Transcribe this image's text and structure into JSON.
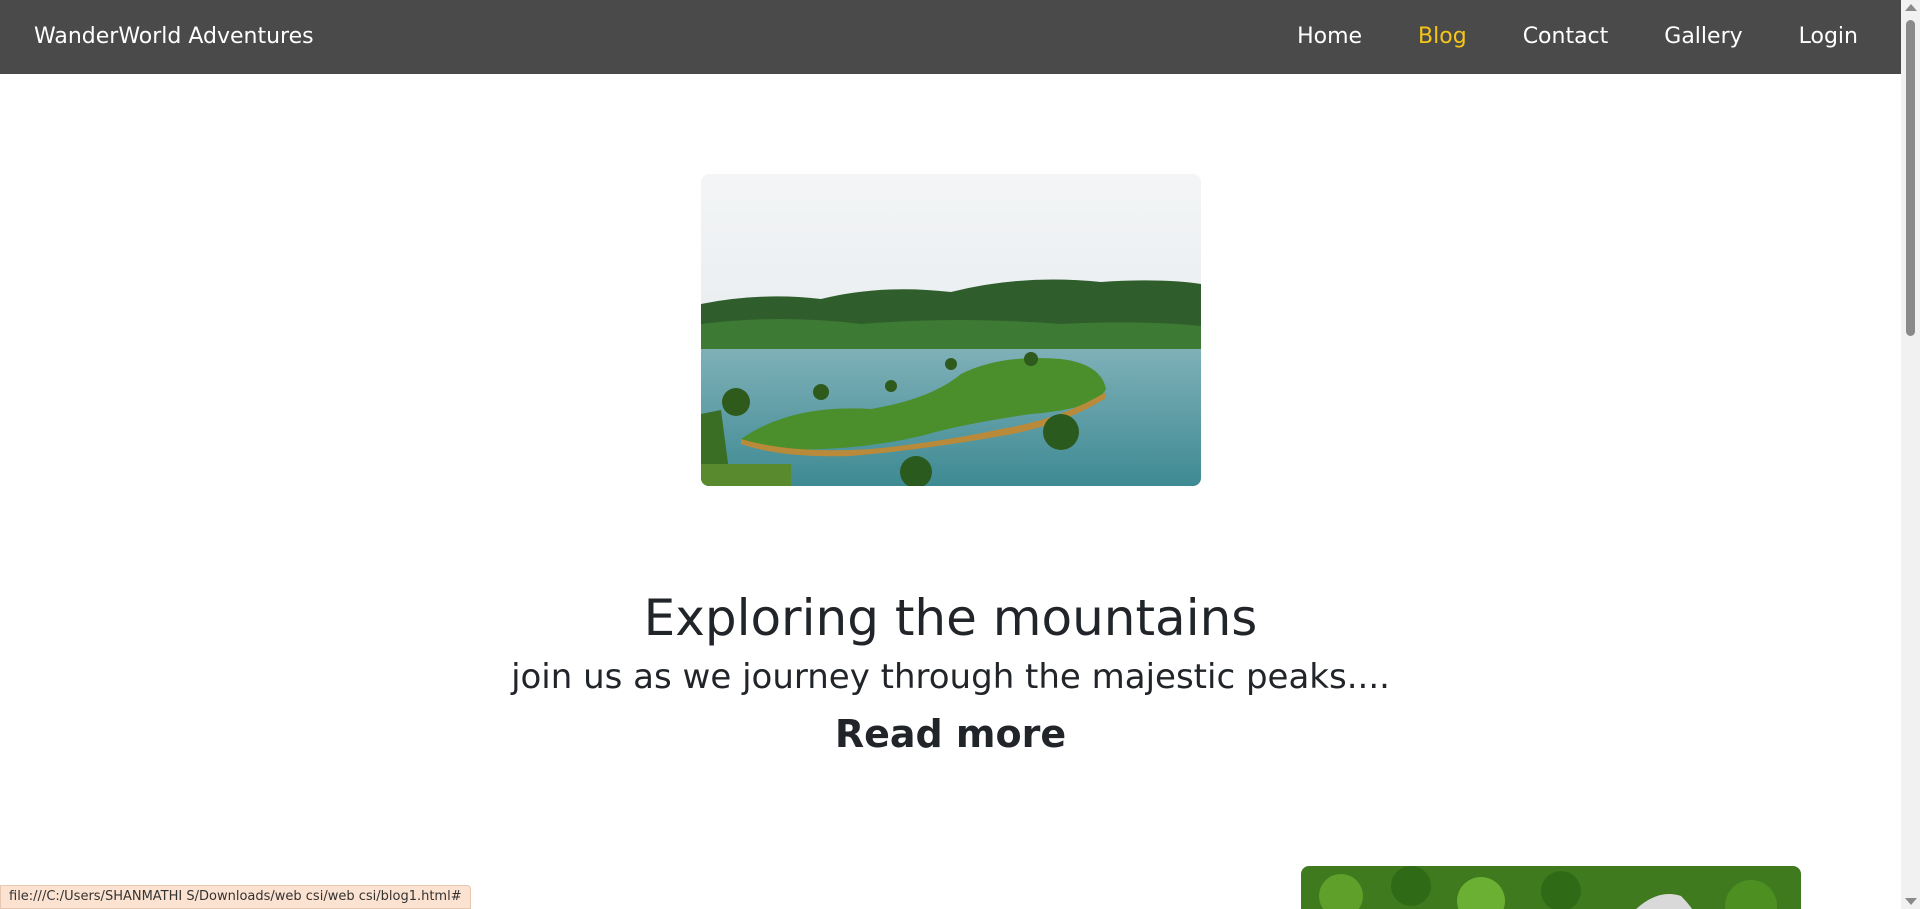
{
  "navbar": {
    "brand": "WanderWorld Adventures",
    "links": [
      {
        "label": "Home",
        "active": false
      },
      {
        "label": "Blog",
        "active": true
      },
      {
        "label": "Contact",
        "active": false
      },
      {
        "label": "Gallery",
        "active": false
      },
      {
        "label": "Login",
        "active": false
      }
    ],
    "background": "#4a4a4a",
    "active_color": "#f5c518"
  },
  "post": {
    "title": "Exploring the mountains",
    "excerpt": "join us as we journey through the majestic peaks....",
    "read_more": "Read more",
    "image": "mountain-lake-landscape"
  },
  "next_post": {
    "image": "forest-aerial-landscape"
  },
  "status_bar": {
    "url": "file:///C:/Users/SHANMATHI S/Downloads/web csi/web csi/blog1.html#"
  }
}
